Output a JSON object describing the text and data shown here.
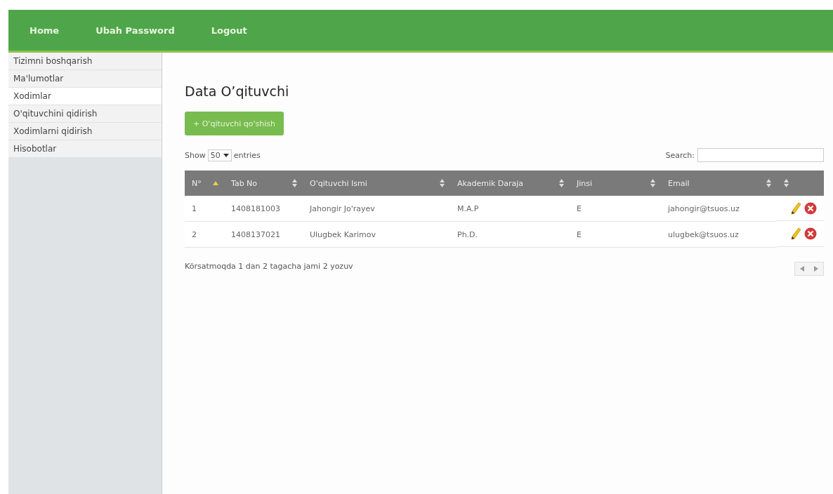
{
  "nav": {
    "items": [
      "Home",
      "Ubah Password",
      "Logout"
    ]
  },
  "sidebar": {
    "items": [
      {
        "label": "Tizimni boshqarish",
        "selected": false
      },
      {
        "label": "Ma'lumotlar",
        "selected": false
      },
      {
        "label": "Xodimlar",
        "selected": true
      },
      {
        "label": "O'qituvchini qidirish",
        "selected": false
      },
      {
        "label": "Xodimlarni qidirish",
        "selected": false
      },
      {
        "label": "Hisobotlar",
        "selected": false
      }
    ]
  },
  "page_title": "Data O’qituvchi",
  "add_button": "+ O'qituvchi qo'shish",
  "length": {
    "prefix": "Show",
    "value": "50",
    "suffix": "entries"
  },
  "search": {
    "label": "Search:"
  },
  "table": {
    "columns": [
      {
        "label": "N°",
        "sorted": true
      },
      {
        "label": "Tab No",
        "sorted": false
      },
      {
        "label": "O'qituvchi Ismi",
        "sorted": false
      },
      {
        "label": "Akademik Daraja",
        "sorted": false
      },
      {
        "label": "Jinsi",
        "sorted": false
      },
      {
        "label": "Email",
        "sorted": false
      },
      {
        "sorted": false
      }
    ],
    "rows": [
      {
        "cells": [
          "1",
          "1408181003",
          "Jahongir Jo'rayev",
          "M.A.P",
          "E",
          "jahongir@tsuos.uz"
        ]
      },
      {
        "cells": [
          "2",
          "1408137021",
          "Ulugbek Karimov",
          "Ph.D.",
          "E",
          "ulugbek@tsuos.uz"
        ]
      }
    ]
  },
  "info": "Körsatmoqda 1 dan 2 tagacha jami 2 yozuv"
}
